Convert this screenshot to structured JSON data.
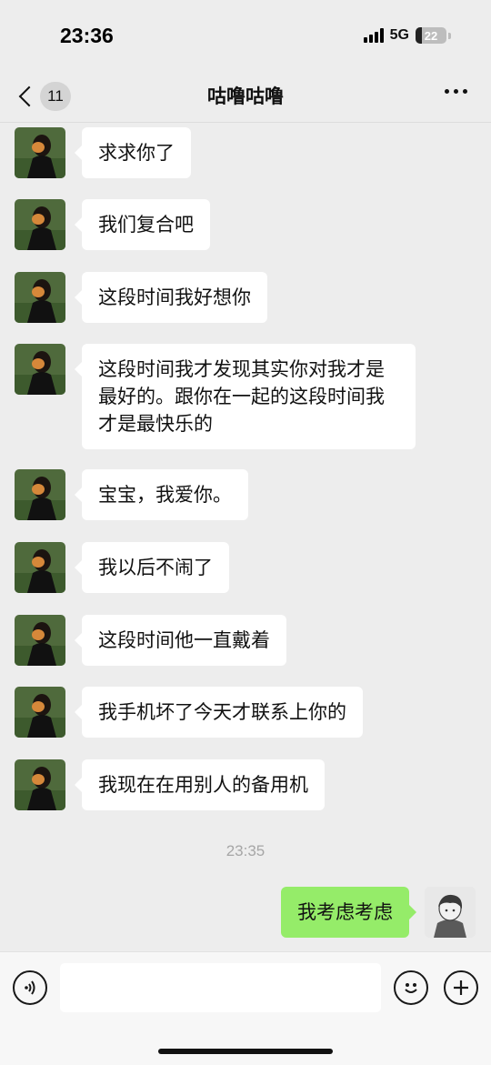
{
  "status_bar": {
    "time": "23:36",
    "network": "5G",
    "battery_level": "22",
    "battery_fraction": 0.22
  },
  "header": {
    "back_icon": "chevron-left-icon",
    "unread_count": "11",
    "title": "咕噜咕噜",
    "more_icon": "more-dots-icon"
  },
  "messages": [
    {
      "sender": "other",
      "text": "求求你了"
    },
    {
      "sender": "other",
      "text": "我们复合吧"
    },
    {
      "sender": "other",
      "text": "这段时间我好想你"
    },
    {
      "sender": "other",
      "text": "这段时间我才发现其实你对我才是最好的。跟你在一起的这段时间我才是最快乐的"
    },
    {
      "sender": "other",
      "text": "宝宝，我爱你。"
    },
    {
      "sender": "other",
      "text": "我以后不闹了"
    },
    {
      "sender": "other",
      "text": "这段时间他一直戴着"
    },
    {
      "sender": "other",
      "text": "我手机坏了今天才联系上你的"
    },
    {
      "sender": "other",
      "text": "我现在在用别人的备用机"
    },
    {
      "sender": "self",
      "text": "我考虑考虑"
    }
  ],
  "timestamp": "23:35",
  "input_bar": {
    "voice_icon": "voice-icon",
    "text_value": "",
    "emoji_icon": "emoji-icon",
    "plus_icon": "plus-icon"
  },
  "colors": {
    "background": "#ededed",
    "bubble_self": "#95ec69",
    "bubble_other": "#ffffff"
  }
}
